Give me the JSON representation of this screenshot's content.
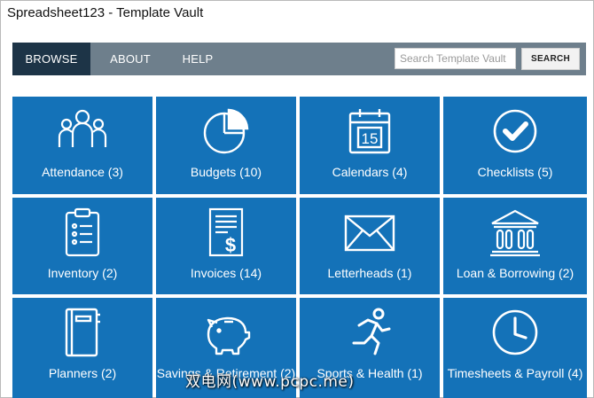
{
  "app": {
    "title": "Spreadsheet123 - Template Vault"
  },
  "nav": {
    "browse": "BROWSE",
    "about": "ABOUT",
    "help": "HELP",
    "search_placeholder": "Search Template Vault",
    "search_button": "SEARCH"
  },
  "tiles": [
    {
      "label": "Attendance (3)",
      "icon": "people-group-icon"
    },
    {
      "label": "Budgets (10)",
      "icon": "pie-chart-icon"
    },
    {
      "label": "Calendars (4)",
      "icon": "calendar-icon",
      "icon_text": "15"
    },
    {
      "label": "Checklists (5)",
      "icon": "checkmark-circle-icon"
    },
    {
      "label": "Inventory (2)",
      "icon": "clipboard-list-icon"
    },
    {
      "label": "Invoices (14)",
      "icon": "invoice-dollar-icon"
    },
    {
      "label": "Letterheads (1)",
      "icon": "envelope-icon"
    },
    {
      "label": "Loan & Borrowing (2)",
      "icon": "bank-icon"
    },
    {
      "label": "Planners (2)",
      "icon": "planner-book-icon"
    },
    {
      "label": "Savings & Retirement (2)",
      "icon": "piggy-bank-icon"
    },
    {
      "label": "Sports & Health (1)",
      "icon": "runner-icon"
    },
    {
      "label": "Timesheets & Payroll (4)",
      "icon": "clock-icon"
    }
  ],
  "watermark": "双电网(www.pcpc.me)",
  "colors": {
    "nav_bg": "#6e7f8c",
    "nav_active": "#1d3447",
    "tile_bg": "#1472b8"
  }
}
